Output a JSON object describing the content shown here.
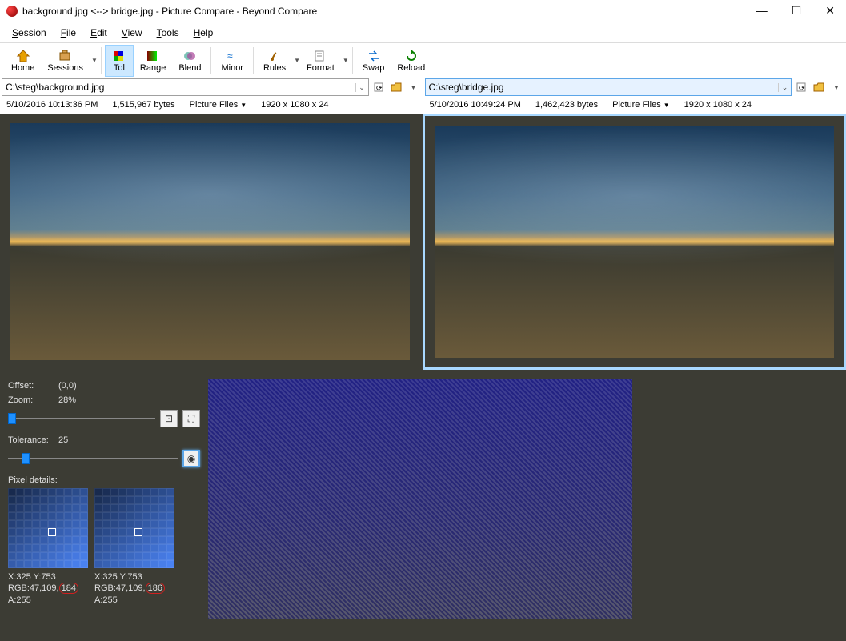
{
  "window": {
    "title": "background.jpg <--> bridge.jpg - Picture Compare - Beyond Compare"
  },
  "menu": {
    "items": [
      "Session",
      "File",
      "Edit",
      "View",
      "Tools",
      "Help"
    ]
  },
  "toolbar": {
    "home": "Home",
    "sessions": "Sessions",
    "tol": "Tol",
    "range": "Range",
    "blend": "Blend",
    "minor": "Minor",
    "rules": "Rules",
    "format": "Format",
    "swap": "Swap",
    "reload": "Reload"
  },
  "left": {
    "path": "C:\\steg\\background.jpg",
    "timestamp": "5/10/2016 10:13:36 PM",
    "bytes": "1,515,967 bytes",
    "filetype": "Picture Files",
    "dims": "1920 x 1080 x 24"
  },
  "right": {
    "path": "C:\\steg\\bridge.jpg",
    "timestamp": "5/10/2016 10:49:24 PM",
    "bytes": "1,462,423 bytes",
    "filetype": "Picture Files",
    "dims": "1920 x 1080 x 24"
  },
  "panel": {
    "offset_label": "Offset:",
    "offset_value": "(0,0)",
    "zoom_label": "Zoom:",
    "zoom_value": "28%",
    "tolerance_label": "Tolerance:",
    "tolerance_value": "25",
    "pixel_details_label": "Pixel details:"
  },
  "pixel": {
    "left": {
      "xy": "X:325 Y:753",
      "rgb_pre": "RGB:47,109,",
      "rgb_last": "184",
      "a": "A:255"
    },
    "right": {
      "xy": "X:325 Y:753",
      "rgb_pre": "RGB:47,109,",
      "rgb_last": "186",
      "a": "A:255"
    }
  }
}
